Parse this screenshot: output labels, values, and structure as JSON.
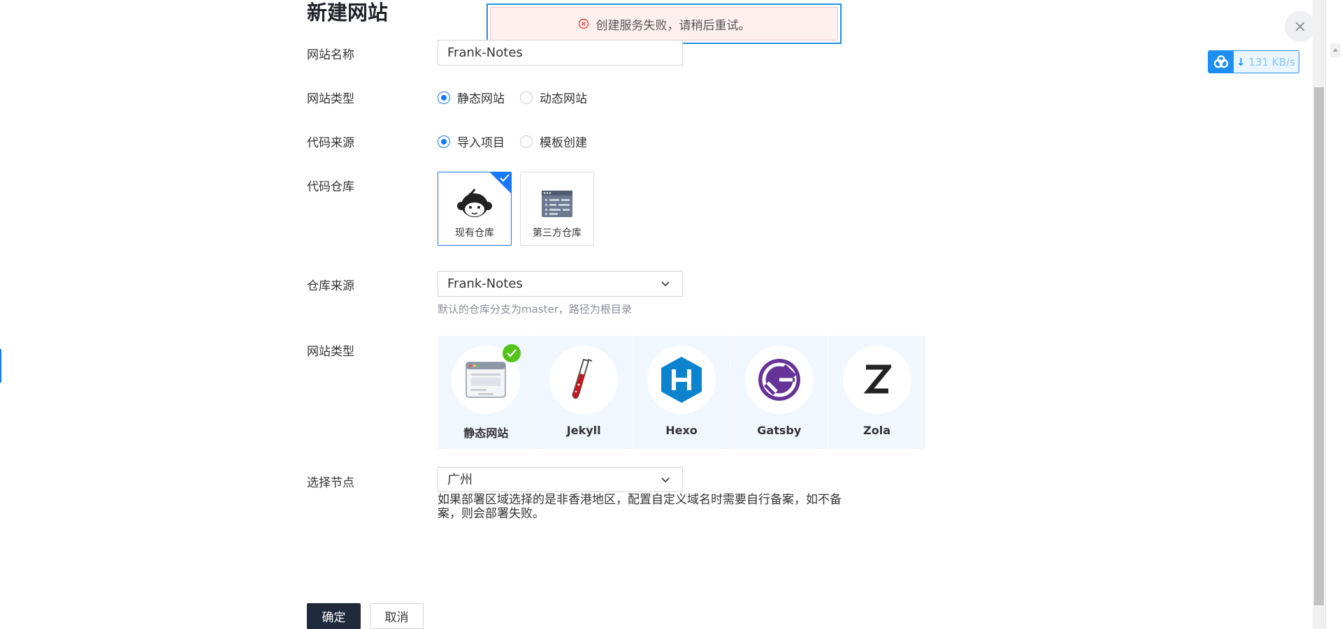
{
  "page": {
    "title": "新建网站"
  },
  "toast": {
    "message": "创建服务失败，请稍后重试。",
    "type": "error"
  },
  "form": {
    "site_name": {
      "label": "网站名称",
      "value": "Frank-Notes"
    },
    "site_type": {
      "label": "网站类型",
      "options": [
        "静态网站",
        "动态网站"
      ],
      "selected": "静态网站"
    },
    "code_source": {
      "label": "代码来源",
      "options": [
        "导入项目",
        "模板创建"
      ],
      "selected": "导入项目"
    },
    "code_repo": {
      "label": "代码仓库",
      "cards": [
        "现有仓库",
        "第三方仓库"
      ],
      "selected": "现有仓库"
    },
    "repo_source": {
      "label": "仓库来源",
      "value": "Frank-Notes",
      "hint": "默认的仓库分支为master，路径为根目录"
    },
    "framework": {
      "label": "网站类型",
      "items": [
        "静态网站",
        "Jekyll",
        "Hexo",
        "Gatsby",
        "Zola"
      ],
      "selected": "静态网站"
    },
    "node": {
      "label": "选择节点",
      "value": "广州",
      "note": "如果部署区域选择的是非香港地区，配置自定义域名时需要自行备案，如不备案，则会部署失败。"
    }
  },
  "actions": {
    "confirm": "确定",
    "cancel": "取消"
  },
  "speed_widget": {
    "value": "131 KB/s",
    "arrow": "↓"
  },
  "close": {
    "symbol": "×"
  },
  "colors": {
    "primary": "#1677ff",
    "dark_button": "#1f2a3c",
    "success": "#52c41a",
    "error": "#e8453c"
  }
}
